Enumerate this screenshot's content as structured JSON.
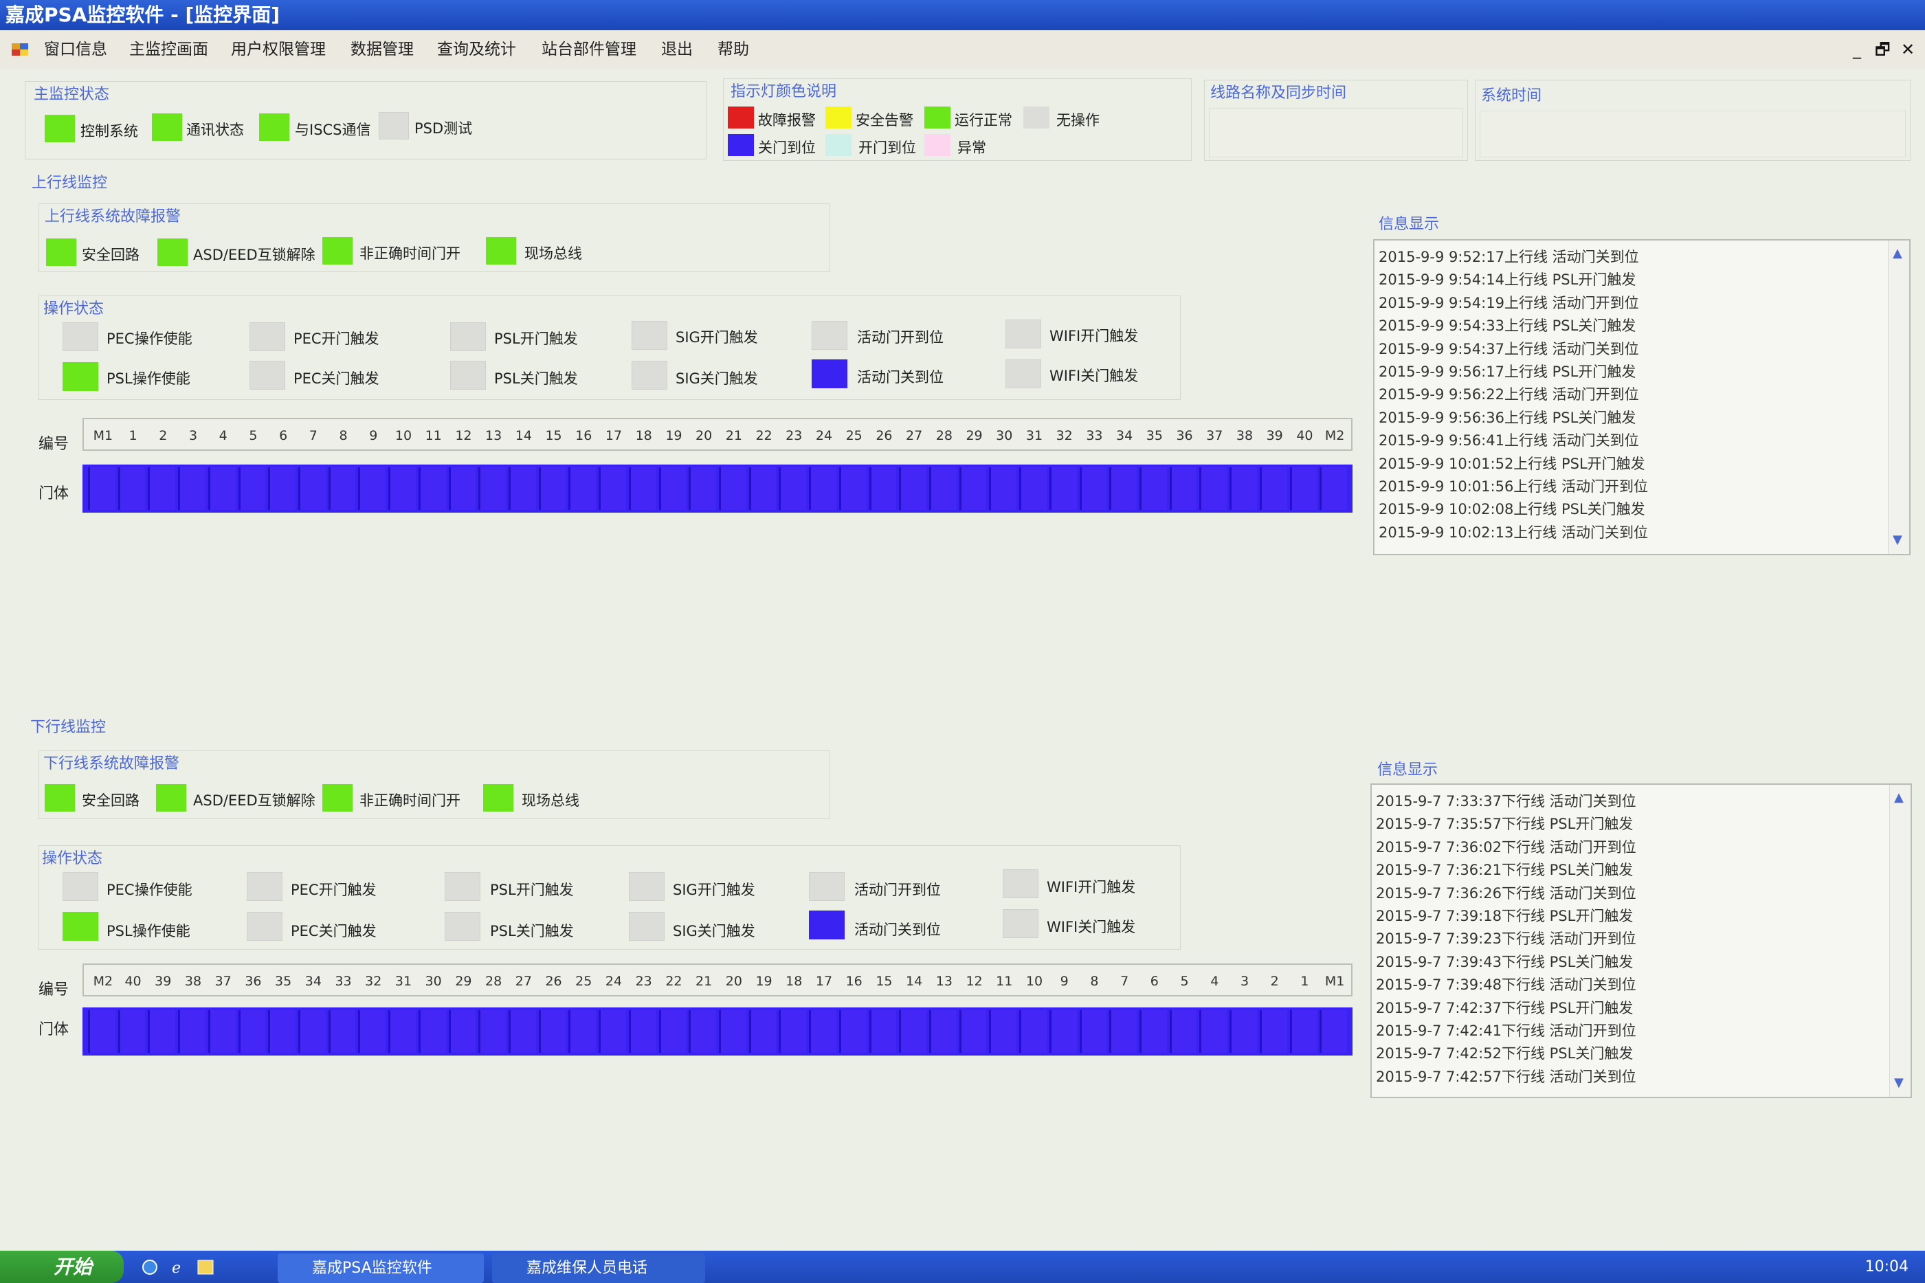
{
  "window": {
    "title": "嘉成PSA监控软件 - [监控界面]"
  },
  "menu": [
    "窗口信息",
    "主监控画面",
    "用户权限管理",
    "数据管理",
    "查询及统计",
    "站台部件管理",
    "退出",
    "帮助"
  ],
  "window_controls": [
    "_",
    "🗗",
    "✕"
  ],
  "main_status": {
    "label": "主监控状态",
    "items": [
      {
        "label": "控制系统",
        "state": "green"
      },
      {
        "label": "通讯状态",
        "state": "green"
      },
      {
        "label": "与ISCS通信",
        "state": "green"
      },
      {
        "label": "PSD测试",
        "state": "gray"
      }
    ]
  },
  "legend": {
    "label": "指示灯颜色说明",
    "items": [
      {
        "label": "故障报警",
        "color": "#e21f1f"
      },
      {
        "label": "安全告警",
        "color": "#f6f61c"
      },
      {
        "label": "运行正常",
        "color": "#6ae61a"
      },
      {
        "label": "无操作",
        "color": "#dcddd9"
      },
      {
        "label": "关门到位",
        "color": "#3a23f2"
      },
      {
        "label": "开门到位",
        "color": "#cdf0ea"
      },
      {
        "label": "异常",
        "color": "#fbd6ee"
      }
    ]
  },
  "line_name_label": "线路名称及同步时间",
  "system_time_label": "系统时间",
  "up": {
    "section_label": "上行线监控",
    "fault_label": "上行线系统故障报警",
    "faults": [
      "安全回路",
      "ASD/EED互锁解除",
      "非正确时间门开",
      "现场总线"
    ],
    "op_label": "操作状态",
    "ops_row1": [
      {
        "label": "PEC操作使能",
        "state": "gray"
      },
      {
        "label": "PEC开门触发",
        "state": "gray"
      },
      {
        "label": "PSL开门触发",
        "state": "gray"
      },
      {
        "label": "SIG开门触发",
        "state": "gray"
      },
      {
        "label": "活动门开到位",
        "state": "gray"
      },
      {
        "label": "WIFI开门触发",
        "state": "gray"
      }
    ],
    "ops_row2": [
      {
        "label": "PSL操作使能",
        "state": "green"
      },
      {
        "label": "PEC关门触发",
        "state": "gray"
      },
      {
        "label": "PSL关门触发",
        "state": "gray"
      },
      {
        "label": "SIG关门触发",
        "state": "gray"
      },
      {
        "label": "活动门关到位",
        "state": "blue"
      },
      {
        "label": "WIFI关门触发",
        "state": "gray"
      }
    ],
    "num_label": "编号",
    "door_label": "门体",
    "numbers": [
      "M1",
      "1",
      "2",
      "3",
      "4",
      "5",
      "6",
      "7",
      "8",
      "9",
      "10",
      "11",
      "12",
      "13",
      "14",
      "15",
      "16",
      "17",
      "18",
      "19",
      "20",
      "21",
      "22",
      "23",
      "24",
      "25",
      "26",
      "27",
      "28",
      "29",
      "30",
      "31",
      "32",
      "33",
      "34",
      "35",
      "36",
      "37",
      "38",
      "39",
      "40",
      "M2"
    ],
    "info_label": "信息显示",
    "info_lines": [
      "2015-9-9 9:52:17上行线 活动门关到位",
      "2015-9-9 9:54:14上行线 PSL开门触发",
      "2015-9-9 9:54:19上行线 活动门开到位",
      "2015-9-9 9:54:33上行线 PSL关门触发",
      "2015-9-9 9:54:37上行线 活动门关到位",
      "2015-9-9 9:56:17上行线 PSL开门触发",
      "2015-9-9 9:56:22上行线 活动门开到位",
      "2015-9-9 9:56:36上行线 PSL关门触发",
      "2015-9-9 9:56:41上行线 活动门关到位",
      "2015-9-9 10:01:52上行线 PSL开门触发",
      "2015-9-9 10:01:56上行线 活动门开到位",
      "2015-9-9 10:02:08上行线 PSL关门触发",
      "2015-9-9 10:02:13上行线 活动门关到位"
    ]
  },
  "down": {
    "section_label": "下行线监控",
    "fault_label": "下行线系统故障报警",
    "faults": [
      "安全回路",
      "ASD/EED互锁解除",
      "非正确时间门开",
      "现场总线"
    ],
    "op_label": "操作状态",
    "ops_row1": [
      {
        "label": "PEC操作使能",
        "state": "gray"
      },
      {
        "label": "PEC开门触发",
        "state": "gray"
      },
      {
        "label": "PSL开门触发",
        "state": "gray"
      },
      {
        "label": "SIG开门触发",
        "state": "gray"
      },
      {
        "label": "活动门开到位",
        "state": "gray"
      },
      {
        "label": "WIFI开门触发",
        "state": "gray"
      }
    ],
    "ops_row2": [
      {
        "label": "PSL操作使能",
        "state": "green"
      },
      {
        "label": "PEC关门触发",
        "state": "gray"
      },
      {
        "label": "PSL关门触发",
        "state": "gray"
      },
      {
        "label": "SIG关门触发",
        "state": "gray"
      },
      {
        "label": "活动门关到位",
        "state": "blue"
      },
      {
        "label": "WIFI关门触发",
        "state": "gray"
      }
    ],
    "num_label": "编号",
    "door_label": "门体",
    "numbers": [
      "M2",
      "40",
      "39",
      "38",
      "37",
      "36",
      "35",
      "34",
      "33",
      "32",
      "31",
      "30",
      "29",
      "28",
      "27",
      "26",
      "25",
      "24",
      "23",
      "22",
      "21",
      "20",
      "19",
      "18",
      "17",
      "16",
      "15",
      "14",
      "13",
      "12",
      "11",
      "10",
      "9",
      "8",
      "7",
      "6",
      "5",
      "4",
      "3",
      "2",
      "1",
      "M1"
    ],
    "info_label": "信息显示",
    "info_lines": [
      "2015-9-7 7:33:37下行线 活动门关到位",
      "2015-9-7 7:35:57下行线 PSL开门触发",
      "2015-9-7 7:36:02下行线 活动门开到位",
      "2015-9-7 7:36:21下行线 PSL关门触发",
      "2015-9-7 7:36:26下行线 活动门关到位",
      "2015-9-7 7:39:18下行线 PSL开门触发",
      "2015-9-7 7:39:23下行线 活动门开到位",
      "2015-9-7 7:39:43下行线 PSL关门触发",
      "2015-9-7 7:39:48下行线 活动门关到位",
      "2015-9-7 7:42:37下行线 PSL开门触发",
      "2015-9-7 7:42:41下行线 活动门开到位",
      "2015-9-7 7:42:52下行线 PSL关门触发",
      "2015-9-7 7:42:57下行线 活动门关到位"
    ]
  },
  "taskbar": {
    "start": "开始",
    "buttons": [
      "嘉成PSA监控软件",
      "嘉成维保人员电话"
    ],
    "clock": "10:04"
  }
}
